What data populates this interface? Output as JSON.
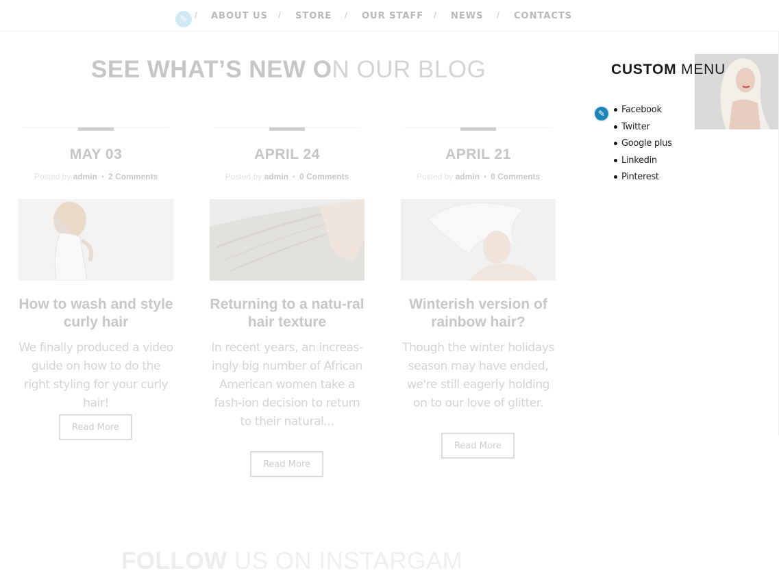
{
  "nav": {
    "items": [
      "ABOUT US",
      "STORE",
      "OUR STAFF",
      "NEWS",
      "CONTACTS"
    ],
    "separator": "/"
  },
  "blog": {
    "title_strong": "SEE WHAT’S NEW O",
    "title_light": "N OUR BLOG"
  },
  "posts": [
    {
      "date": "MAY 03",
      "posted_by": "Posted by",
      "author": "admin",
      "comments": "2 Comments",
      "heading": "How to wash and style curly hair",
      "excerpt": "We finally produced a video guide on how to do the right styling for your curly hair!",
      "button": "Read More"
    },
    {
      "date": "APRIL 24",
      "posted_by": "Posted by",
      "author": "admin",
      "comments": "0 Comments",
      "heading": "Returning to a natu-ral hair texture",
      "excerpt": "In recent years, an increas-ingly big number of African American women take a fash-ion decision to return to their natural...",
      "button": "Read More"
    },
    {
      "date": "APRIL 21",
      "posted_by": "Posted by",
      "author": "admin",
      "comments": "0 Comments",
      "heading": "Winterish version of rainbow hair?",
      "excerpt": "Though the winter holidays season may have ended, we're still eagerly holding on to our love of glitter.",
      "button": "Read More"
    }
  ],
  "instagram": {
    "title_strong": "FOLLOW",
    "title_light": " US ON INSTARGAM"
  },
  "widget": {
    "title_strong": "CUSTOM",
    "title_light": " MENU",
    "items": [
      "Facebook",
      "Twitter",
      "Google plus",
      "Linkedin",
      "Pinterest"
    ]
  },
  "icons": {
    "nav_edit": "pencil-icon",
    "widget_edit": "pencil-icon"
  },
  "colors": {
    "accent": "#1f84b8",
    "accent_faded": "#cfe8f3"
  }
}
